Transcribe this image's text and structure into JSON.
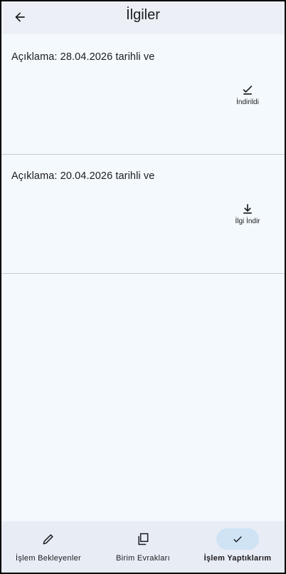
{
  "app_bar": {
    "title": "İlgiler",
    "back_icon": "arrow-left-icon"
  },
  "items": [
    {
      "description": "Açıklama: 28.04.2026 tarihli ve",
      "action_label": "İndirildi",
      "action_icon": "check-icon"
    },
    {
      "description": "Açıklama: 20.04.2026 tarihli ve",
      "action_label": "İlgi İndir",
      "action_icon": "download-icon"
    }
  ],
  "bottom_nav": {
    "items": [
      {
        "label": "İşlem Bekleyenler",
        "icon": "pencil-icon",
        "active": false
      },
      {
        "label": "Birim Evrakları",
        "icon": "copy-icon",
        "active": false
      },
      {
        "label": "İşlem Yaptıklarım",
        "icon": "check-icon",
        "active": true
      }
    ],
    "active_indicator_color": "#cfe3f5"
  },
  "colors": {
    "background": "#f4f9fd",
    "app_bar": "#ecf0f6",
    "nav_bar": "#e8ecf4",
    "divider": "#c9ccd2",
    "text": "#1b1c1f"
  }
}
